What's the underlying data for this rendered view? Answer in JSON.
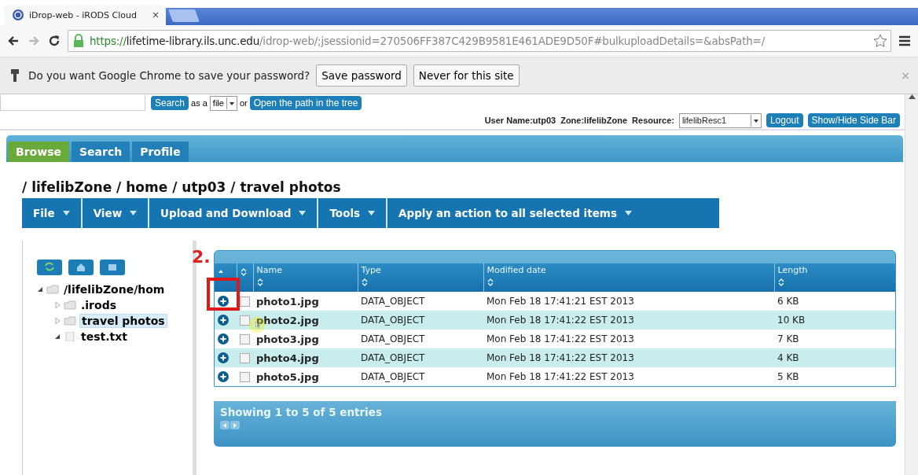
{
  "browser_tab": {
    "title": "iDrop-web - iRODS Cloud",
    "close": "×"
  },
  "address_bar": {
    "scheme": "https://",
    "host": "lifetime-library.ils.unc.edu",
    "path": "/idrop-web/;jsessionid=270506FF387C429B9581E461ADE9D50F#bulkuploadDetails=&absPath=/"
  },
  "infobar": {
    "message": "Do you want Google Chrome to save your password?",
    "buttons": [
      "Save password",
      "Never for this site"
    ],
    "close": "×"
  },
  "search_row": {
    "button": "Search",
    "as_label": "as a",
    "type_select": "file",
    "or_label": "or",
    "open_button": "Open the path in the tree"
  },
  "user_row": {
    "user": "User Name:utp03",
    "zone": "Zone:lifelibZone",
    "resource_label": "Resource:",
    "resource_select": "lifelibResc1",
    "buttons": [
      "Logout",
      "Show/Hide Side Bar"
    ]
  },
  "tabs": [
    {
      "label": "Browse",
      "selected": true
    },
    {
      "label": "Search",
      "selected": false
    },
    {
      "label": "Profile",
      "selected": false
    }
  ],
  "breadcrumb": "/ lifelibZone / home / utp03 / travel photos",
  "menu": [
    "File",
    "View",
    "Upload and Download",
    "Tools",
    "Apply an action to all selected items"
  ],
  "tree": [
    {
      "label": "/lifelibZone/hom",
      "kind": "folder",
      "expanded": true,
      "selected": false,
      "children": [
        {
          "label": ".irods",
          "kind": "folder",
          "expanded": false,
          "selected": false
        },
        {
          "label": "travel photos",
          "kind": "folder",
          "expanded": false,
          "selected": true
        },
        {
          "label": "test.txt",
          "kind": "file",
          "expanded": true,
          "selected": false
        }
      ]
    }
  ],
  "table": {
    "columns": [
      "Name",
      "Type",
      "Modified date",
      "Length"
    ],
    "rows": [
      {
        "name": "photo1.jpg",
        "type": "DATA_OBJECT",
        "modified": "Mon Feb 18 17:41:21 EST 2013",
        "length": "6 KB",
        "checked": false
      },
      {
        "name": "photo2.jpg",
        "type": "DATA_OBJECT",
        "modified": "Mon Feb 18 17:41:22 EST 2013",
        "length": "10 KB",
        "checked": false
      },
      {
        "name": "photo3.jpg",
        "type": "DATA_OBJECT",
        "modified": "Mon Feb 18 17:41:22 EST 2013",
        "length": "7 KB",
        "checked": false
      },
      {
        "name": "photo4.jpg",
        "type": "DATA_OBJECT",
        "modified": "Mon Feb 18 17:41:22 EST 2013",
        "length": "4 KB",
        "checked": false
      },
      {
        "name": "photo5.jpg",
        "type": "DATA_OBJECT",
        "modified": "Mon Feb 18 17:41:22 EST 2013",
        "length": "5 KB",
        "checked": false
      }
    ]
  },
  "footer": "Showing 1 to 5 of 5 entries",
  "annotation": "2."
}
